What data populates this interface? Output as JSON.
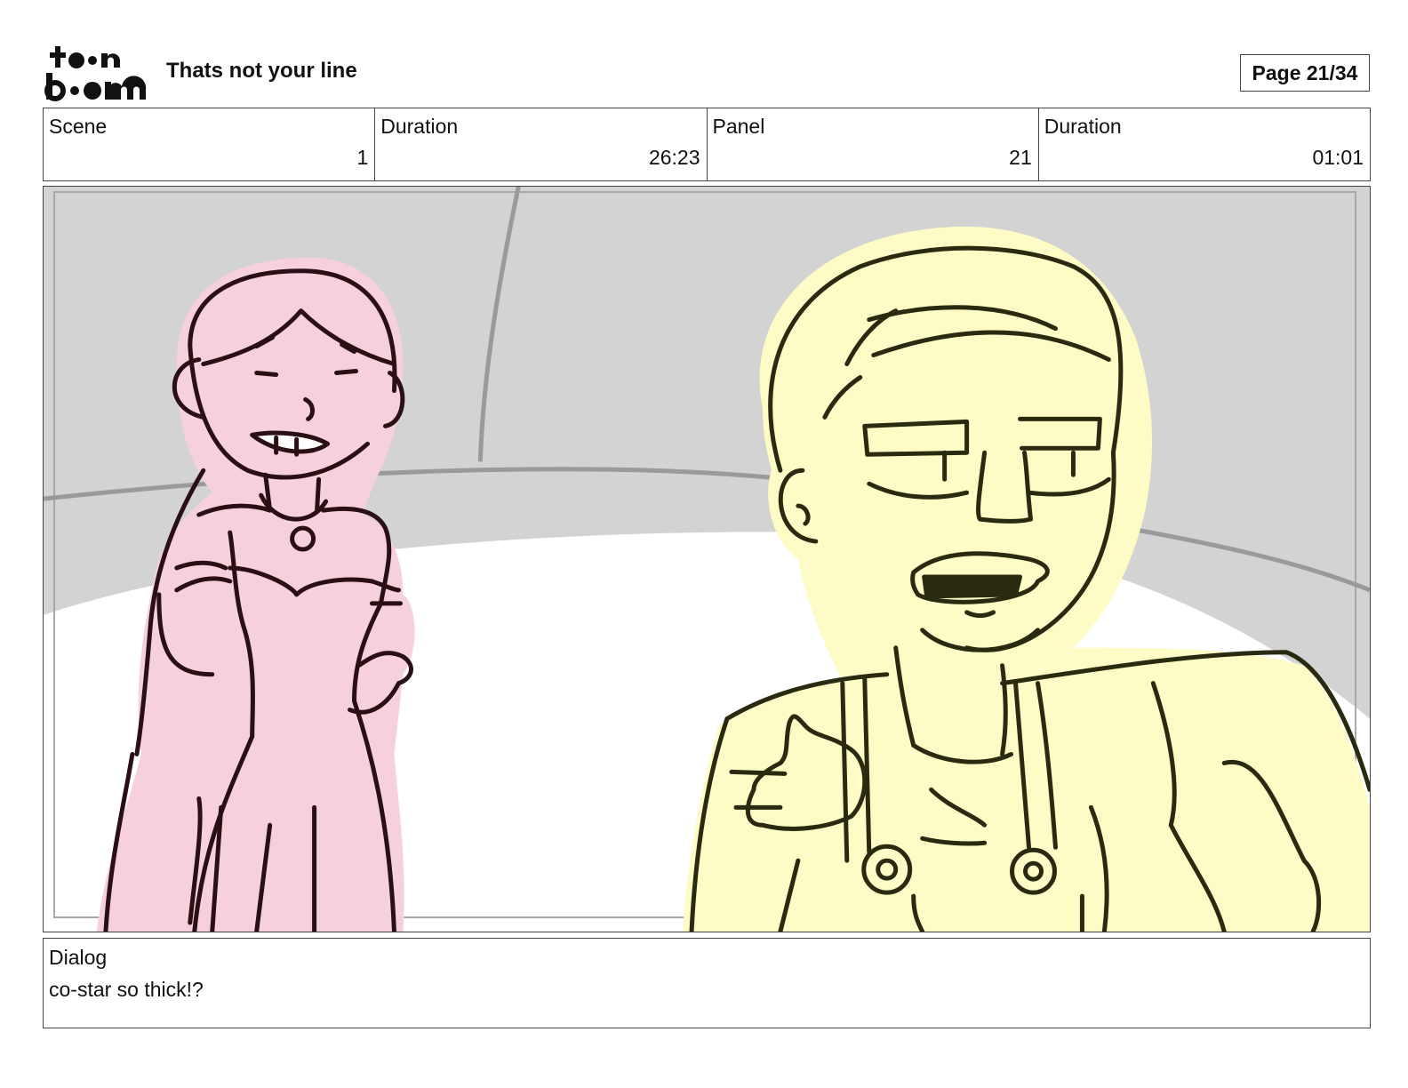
{
  "header": {
    "logo_text": "toonboom",
    "title": "Thats not your line",
    "page_label": "Page 21/34"
  },
  "info": {
    "scene_label": "Scene",
    "scene_value": "1",
    "scene_duration_label": "Duration",
    "scene_duration_value": "26:23",
    "panel_label": "Panel",
    "panel_value": "21",
    "panel_duration_label": "Duration",
    "panel_duration_value": "01:01"
  },
  "dialog": {
    "label": "Dialog",
    "text": "co-star so thick!?"
  },
  "colors": {
    "background_gray": "#d3d3d3",
    "floor_white": "#ffffff",
    "woman_fill": "#f7d0dd",
    "woman_line": "#2a0f14",
    "man_fill": "#fdfbc6",
    "man_line": "#2a2a10"
  }
}
